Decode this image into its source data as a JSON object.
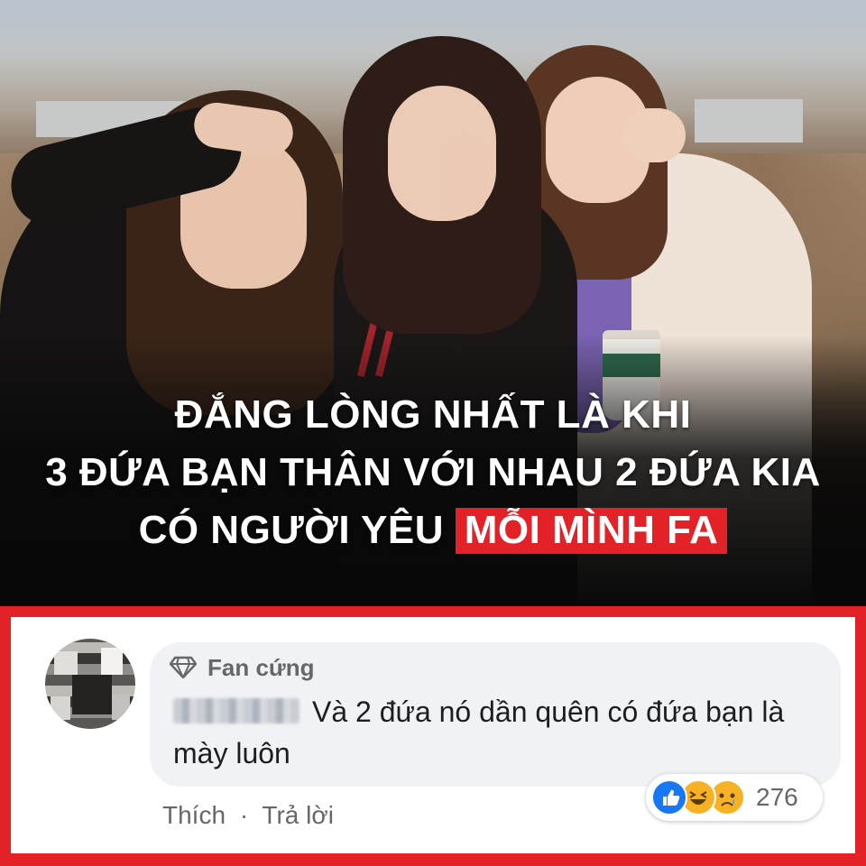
{
  "headline": {
    "line1": "ĐẮNG LÒNG NHẤT LÀ KHI",
    "line2": "3 ĐỨA BẠN THÂN VỚI NHAU 2 ĐỨA KIA",
    "line3_prefix": "CÓ NGƯỜI YÊU",
    "line3_highlight": "MỖI MÌNH FA"
  },
  "comment": {
    "badge_icon": "diamond-icon",
    "badge_label": "Fan cứng",
    "text": "Và 2 đứa nó dần quên có đứa bạn là mày luôn",
    "reactions": {
      "icons": [
        "like-icon",
        "haha-icon",
        "sad-icon"
      ],
      "count": "276"
    },
    "actions": {
      "like": "Thích",
      "separator": "·",
      "reply": "Trả lời"
    }
  },
  "colors": {
    "accent_red": "#e32228",
    "bubble_bg": "#f0f2f5",
    "meta_text": "#65676b",
    "like_blue": "#1877f2",
    "emoji_yellow": "#f7b125"
  }
}
